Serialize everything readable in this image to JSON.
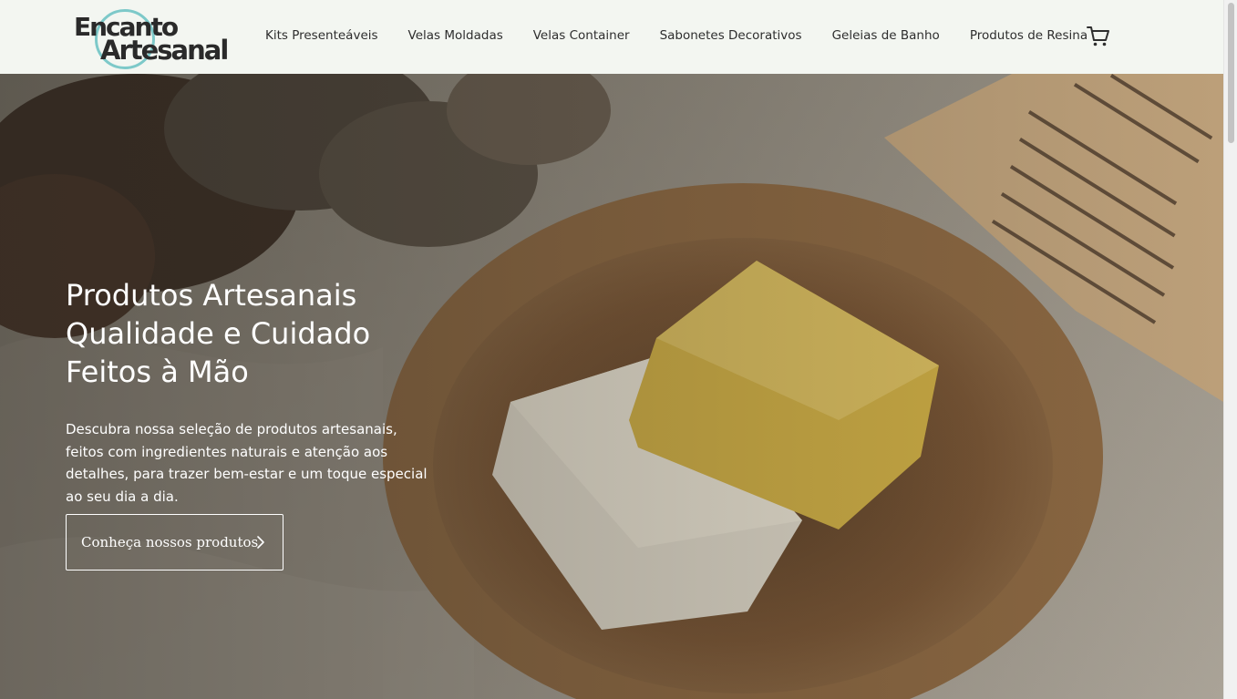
{
  "brand": {
    "logo_line1": "Encanto",
    "logo_line2": "Artesanal",
    "ring_color": "#7dc9c9"
  },
  "nav": {
    "items": [
      {
        "label": "Kits Presenteáveis"
      },
      {
        "label": "Velas Moldadas"
      },
      {
        "label": "Velas Container"
      },
      {
        "label": "Sabonetes Decorativos"
      },
      {
        "label": "Geleias de Banho"
      },
      {
        "label": "Produtos de Resina"
      }
    ],
    "cart_icon": "shopping-cart-icon"
  },
  "hero": {
    "title_lines": [
      "Produtos Artesanais",
      "Qualidade e Cuidado",
      "Feitos à Mão"
    ],
    "description": "Descubra nossa seleção de produtos artesanais, feitos com ingredientes naturais e atenção aos detalhes, para trazer bem-estar e um toque especial ao seu dia a dia.",
    "cta_label": "Conheça nossos produtos",
    "cta_icon": "chevron-right-icon"
  },
  "colors": {
    "header_bg": "#f3f6f1",
    "text_dark": "#2e2e2e",
    "hero_text": "#ffffff"
  }
}
